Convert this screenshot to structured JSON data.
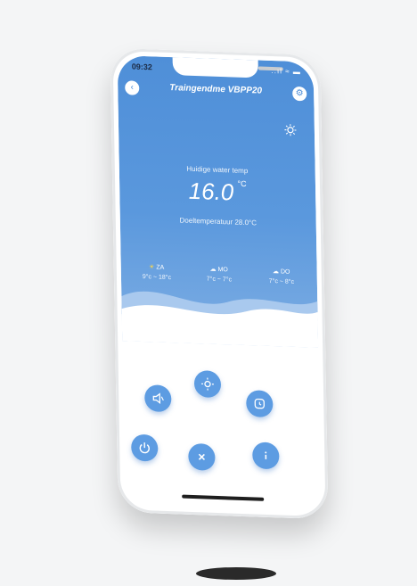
{
  "status_bar": {
    "time": "09:32",
    "right": "..ıl ≈ ▬"
  },
  "header": {
    "title": "Traingendme VBPP20"
  },
  "main": {
    "water_label": "Huidige water temp",
    "water_temp": "16.0",
    "water_unit": "°C",
    "setpoint_label": "Doeltemperatuur",
    "setpoint_value": "28.0°C"
  },
  "weather": [
    {
      "day": "ZA",
      "range": "9°c ~ 18°c",
      "icon": "sun-icon"
    },
    {
      "day": "MO",
      "range": "7°c ~ 7°c",
      "icon": "cloud-icon"
    },
    {
      "day": "DO",
      "range": "7°c ~ 8°c",
      "icon": "cloud-icon"
    }
  ],
  "controls": [
    {
      "name": "mute-button",
      "icon": "speaker-icon"
    },
    {
      "name": "mode-button",
      "icon": "sun-icon"
    },
    {
      "name": "timer-button",
      "icon": "clock-icon"
    },
    {
      "name": "power-button",
      "icon": "power-icon"
    },
    {
      "name": "close-button",
      "icon": "close-icon"
    },
    {
      "name": "info-button",
      "icon": "info-icon"
    }
  ],
  "colors": {
    "accent": "#4f8fd8",
    "button": "#5d9ce2",
    "background": "#f4f5f6"
  }
}
